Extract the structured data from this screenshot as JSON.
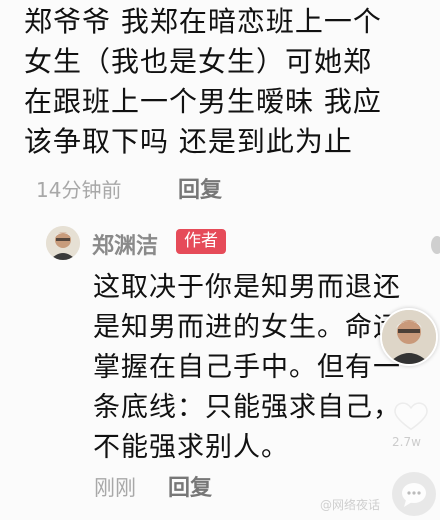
{
  "comment": {
    "text": "郑爷爷 我郑在暗恋班上一个\n女生（我也是女生）可她郑\n在跟班上一个男生暧昧 我应\n该争取下吗 还是到此为止",
    "time": "14分钟前",
    "reply_label": "回复"
  },
  "author_reply": {
    "name": "郑渊洁",
    "badge": "作者",
    "text": "这取决于你是知男而退还\n是知男而进的女生。命运\n掌握在自己手中。但有一\n条底线：只能强求自己，\n不能强求别人。",
    "time": "刚刚",
    "reply_label": "回复"
  },
  "sidebar": {
    "like_count": "2.7w"
  },
  "watermark": "@网络夜话"
}
